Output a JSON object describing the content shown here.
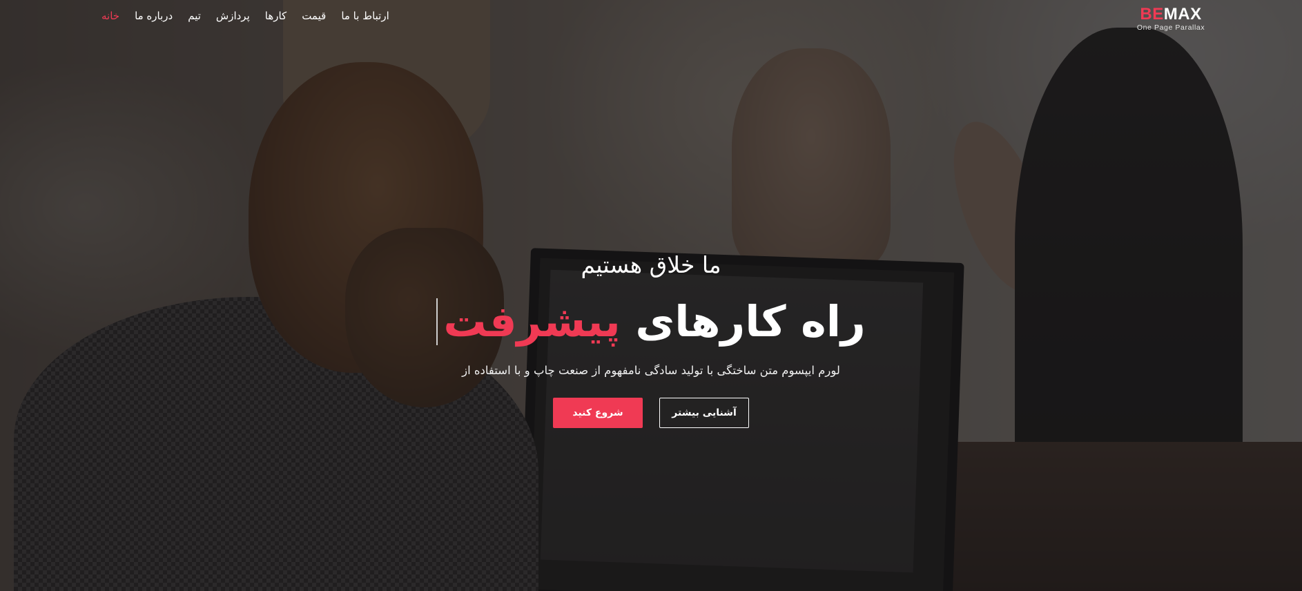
{
  "brand": {
    "logo_part1": "BE",
    "logo_part2": "MAX",
    "tagline": "One Page Parallax",
    "accent_color": "#f03a54"
  },
  "nav": {
    "items": [
      {
        "label": "خانه",
        "active": true
      },
      {
        "label": "درباره ما",
        "active": false
      },
      {
        "label": "تیم",
        "active": false
      },
      {
        "label": "پردازش",
        "active": false
      },
      {
        "label": "کارها",
        "active": false
      },
      {
        "label": "قیمت",
        "active": false
      },
      {
        "label": "ارتباط با ما",
        "active": false
      }
    ]
  },
  "hero": {
    "subtitle": "ما خلاق هستیم",
    "title_main": "راه کارهای",
    "title_accent": "پیشرفت",
    "description": "لورم ایپسوم متن ساختگی با تولید سادگی نامفهوم از صنعت چاپ و با استفاده از",
    "primary_button": "شروع کنید",
    "secondary_button": "آشنایی بیشتر"
  }
}
